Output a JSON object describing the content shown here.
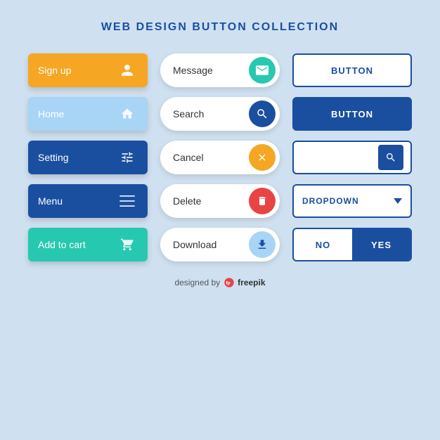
{
  "title": "WEB DESIGN BUTTON COLLECTION",
  "col1": {
    "buttons": [
      {
        "label": "Sign up",
        "class": "btn-signup",
        "icon": "person"
      },
      {
        "label": "Home",
        "class": "btn-home",
        "icon": "home"
      },
      {
        "label": "Setting",
        "class": "btn-setting",
        "icon": "settings"
      },
      {
        "label": "Menu",
        "class": "btn-menu",
        "icon": "menu"
      },
      {
        "label": "Add to cart",
        "class": "btn-addtocart",
        "icon": "cart"
      }
    ]
  },
  "col2": {
    "buttons": [
      {
        "label": "Message",
        "class": "pill-message",
        "icon": "envelope"
      },
      {
        "label": "Search",
        "class": "pill-search",
        "icon": "search"
      },
      {
        "label": "Cancel",
        "class": "pill-cancel",
        "icon": "x"
      },
      {
        "label": "Delete",
        "class": "pill-delete",
        "icon": "trash"
      },
      {
        "label": "Download",
        "class": "pill-download",
        "icon": "download"
      }
    ]
  },
  "col3": {
    "buttons": [
      {
        "type": "outline",
        "label": "BUTTON"
      },
      {
        "type": "filled",
        "label": "BUTTON"
      },
      {
        "type": "search-box",
        "label": ""
      },
      {
        "type": "dropdown",
        "label": "DROPDOWN"
      },
      {
        "type": "no-yes",
        "no": "NO",
        "yes": "YES"
      }
    ]
  },
  "footer": {
    "text": "designed by",
    "brand": "freepik"
  }
}
